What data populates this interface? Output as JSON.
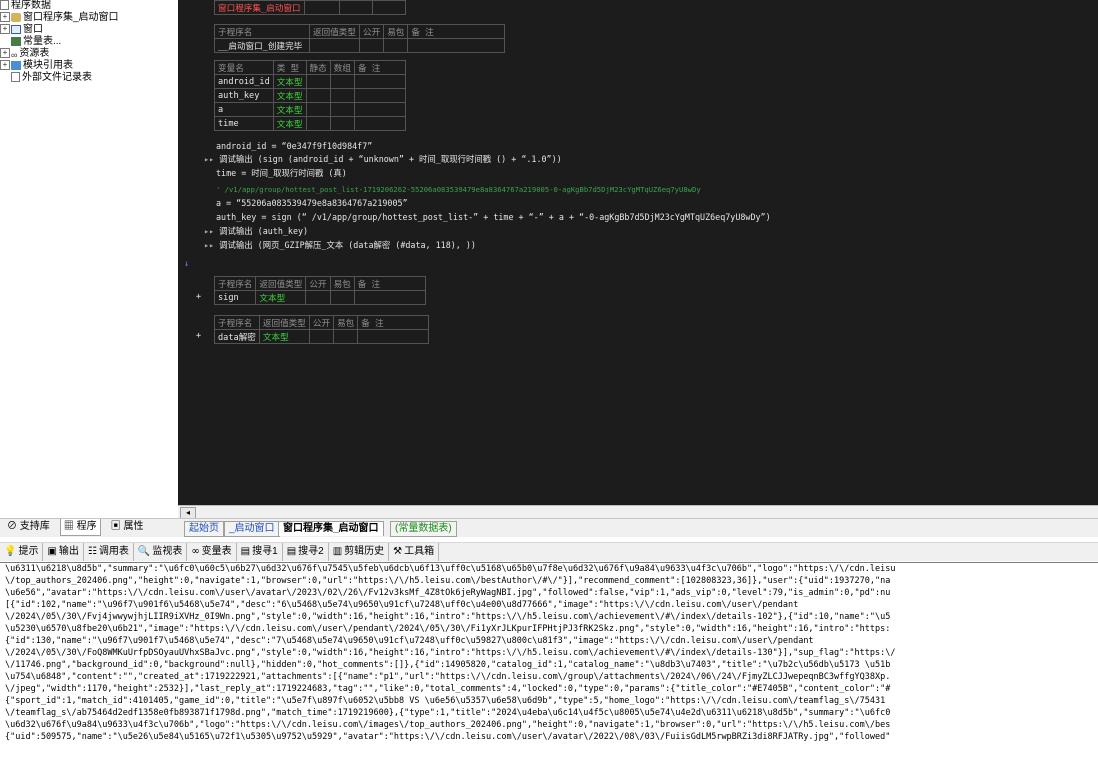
{
  "tree": [
    {
      "toggle": "",
      "icon": "file",
      "label": "程序数据"
    },
    {
      "toggle": "+",
      "icon": "db",
      "label": "窗口程序集_启动窗口"
    },
    {
      "toggle": "+",
      "icon": "win",
      "label": "窗口"
    },
    {
      "toggle": "",
      "icon": "const",
      "label": "常量表..."
    },
    {
      "toggle": "+",
      "icon": "res",
      "label": "资源表"
    },
    {
      "toggle": "+",
      "icon": "mod",
      "label": "模块引用表"
    },
    {
      "toggle": "",
      "icon": "file",
      "label": "外部文件记录表"
    }
  ],
  "code": {
    "top_label": "窗口程序集_启动窗口",
    "sub_header": [
      "子程序名",
      "返回值类型",
      "公开",
      "易包",
      "备 注"
    ],
    "sub_name": "__启动窗口_创建完毕",
    "var_header": [
      "变量名",
      "类 型",
      "静态",
      "数组",
      "备 注"
    ],
    "vars": [
      {
        "name": "android_id",
        "type": "文本型"
      },
      {
        "name": "auth_key",
        "type": "文本型"
      },
      {
        "name": "a",
        "type": "文本型"
      },
      {
        "name": "time",
        "type": "文本型"
      }
    ],
    "line1": "android_id = “0e347f9f10d984f7”",
    "line2": "调试输出 (sign (android_id + “unknown” + 时间_取现行时间戳 () + “.1.0”))",
    "line3": "time = 时间_取现行时间戳 (真)",
    "line4": "' /v1/app/group/hottest_post_list-1719206262-55206a083539479e8a8364767a219005-0-agKgBb7d5DjM23cYgMTqUZ6eq7yU8wDy",
    "line5": "a = “55206a083539479e8a8364767a219005”",
    "line6": "auth_key = sign (“ /v1/app/group/hottest_post_list-” + time + “-” + a + “-0-agKgBb7d5DjM23cYgMTqUZ6eq7yU8wDy”)",
    "line7": "调试输出 (auth_key)",
    "line8": "调试输出 (网页_GZIP解压_文本 (data解密 (#data, 118), ))",
    "sign_header": [
      "子程序名",
      "返回值类型",
      "公开",
      "易包",
      "备 注"
    ],
    "sign_name": "sign",
    "sign_type": "文本型",
    "dec_header": [
      "子程序名",
      "返回值类型",
      "公开",
      "易包",
      "备 注"
    ],
    "dec_name": "data解密",
    "dec_type": "文本型"
  },
  "left_tabs": [
    "支持库",
    "程序",
    "属性"
  ],
  "editor_tabs": [
    "起始页",
    "_启动窗口",
    "窗口程序集_启动窗口",
    "(常量数据表)"
  ],
  "output_toolbar": [
    {
      "icon": "tip-icon",
      "sym": "💡",
      "label": "提示"
    },
    {
      "icon": "output-icon",
      "sym": "▣",
      "label": "输出"
    },
    {
      "icon": "calltable-icon",
      "sym": "☷",
      "label": "调用表"
    },
    {
      "icon": "monitor-icon",
      "sym": "🔍",
      "label": "监视表"
    },
    {
      "icon": "vartable-icon",
      "sym": "∞",
      "label": "变量表"
    },
    {
      "icon": "search1-icon",
      "sym": "▤",
      "label": "搜寻1"
    },
    {
      "icon": "search2-icon",
      "sym": "▤",
      "label": "搜寻2"
    },
    {
      "icon": "clipboard-icon",
      "sym": "▥",
      "label": "剪辑历史"
    },
    {
      "icon": "toolbox-icon",
      "sym": "⚒",
      "label": "工具箱"
    }
  ],
  "output_lines": [
    "\\u6311\\u6218\\u8d5b\",\"summary\":\"\\u6fc0\\u60c5\\u6b27\\u6d32\\u676f\\u7545\\u5feb\\u6dcb\\u6f13\\uff0c\\u5168\\u65b0\\u7f8e\\u6d32\\u676f\\u9a84\\u9633\\u4f3c\\u706b\",\"logo\":\"https:\\/\\/cdn.leisu",
    "\\/top_authors_202406.png\",\"height\":0,\"navigate\":1,\"browser\":0,\"url\":\"https:\\/\\/h5.leisu.com\\/bestAuthor\\/#\\/\"}],\"recommend_comment\":[102808323,36]},\"user\":{\"uid\":1937270,\"na",
    "\\u6e56\",\"avatar\":\"https:\\/\\/cdn.leisu.com\\/user\\/avatar\\/2023\\/02\\/26\\/Fv12v3ksMf_4Z8tOk6jeRyWagNBI.jpg\",\"followed\":false,\"vip\":1,\"ads_vip\":0,\"level\":79,\"is_admin\":0,\"pd\":nu",
    "[{\"id\":102,\"name\":\"\\u96f7\\u901f6\\u5468\\u5e74\",\"desc\":\"6\\u5468\\u5e74\\u9650\\u91cf\\u7248\\uff0c\\u4e00\\u8d77666\",\"image\":\"https:\\/\\/cdn.leisu.com\\/user\\/pendant",
    "\\/2024\\/05\\/30\\/Fvj4jwwywjhjLIIR9iXVHz_0I9Wn.png\",\"style\":0,\"width\":16,\"height\":16,\"intro\":\"https:\\/\\/h5.leisu.com\\/achievement\\/#\\/index\\/details-102\"},{\"id\":10,\"name\":\"\\u5",
    "\\u5230\\u6570\\u8fbe20\\u6b21\",\"image\":\"https:\\/\\/cdn.leisu.com\\/user\\/pendant\\/2024\\/05\\/30\\/Fi1yXrJLKpurIFPHtjPJ3fRK2Skz.png\",\"style\":0,\"width\":16,\"height\":16,\"intro\":\"https:",
    "{\"id\":130,\"name\":\"\\u96f7\\u901f7\\u5468\\u5e74\",\"desc\":\"7\\u5468\\u5e74\\u9650\\u91cf\\u7248\\uff0c\\u59827\\u800c\\u81f3\",\"image\":\"https:\\/\\/cdn.leisu.com\\/user\\/pendant",
    "\\/2024\\/05\\/30\\/FoQ8WMKuUrfpDSOyauUVhxSBaJvc.png\",\"style\":0,\"width\":16,\"height\":16,\"intro\":\"https:\\/\\/h5.leisu.com\\/achievement\\/#\\/index\\/details-130\"}],\"sup_flag\":\"https:\\/",
    "\\/11746.png\",\"background_id\":0,\"background\":null},\"hidden\":0,\"hot_comments\":[]},{\"id\":14905820,\"catalog_id\":1,\"catalog_name\":\"\\u8db3\\u7403\",\"title\":\"\\u7b2c\\u56db\\u5173 \\u51b",
    "\\u754\\u6848\",\"content\":\"\",\"created_at\":1719222921,\"attachments\":[{\"name\":\"p1\",\"url\":\"https:\\/\\/cdn.leisu.com\\/group\\/attachments\\/2024\\/06\\/24\\/FjmyZLCJJwepeqnBC3wffgYQ38Xp.",
    "\\/jpeg\",\"width\":1170,\"height\":2532}],\"last_reply_at\":1719224683,\"tag\":\"\",\"like\":0,\"total_comments\":4,\"locked\":0,\"type\":0,\"params\":{\"title_color\":\"#E7405B\",\"content_color\":\"#",
    "{\"sport_id\":1,\"match_id\":4101405,\"game_id\":0,\"title\":\"\\u5e7f\\u897f\\u6052\\u5bb8 VS \\u6e56\\u5357\\u6e58\\u6d9b\",\"type\":5,\"home_logo\":\"https:\\/\\/cdn.leisu.com\\/teamflag_s\\/75431",
    "\\/teamflag_s\\/ab75464d2edf1358e0fb893871f1798d.png\",\"match_time\":1719219600},{\"type\":1,\"title\":\"2024\\u4eba\\u6c14\\u4f5c\\u8005\\u5e74\\u4e2d\\u6311\\u6218\\u8d5b\",\"summary\":\"\\u6fc0",
    "\\u6d32\\u676f\\u9a84\\u9633\\u4f3c\\u706b\",\"logo\":\"https:\\/\\/cdn.leisu.com\\/images\\/top_authors_202406.png\",\"height\":0,\"navigate\":1,\"browser\":0,\"url\":\"https:\\/\\/h5.leisu.com\\/bes",
    "{\"uid\":509575,\"name\":\"\\u5e26\\u5e84\\u5165\\u72f1\\u5305\\u9752\\u5929\",\"avatar\":\"https:\\/\\/cdn.leisu.com\\/user\\/avatar\\/2022\\/08\\/03\\/FuiisGdLM5rwpBRZi3di8RFJATRy.jpg\",\"followed\""
  ]
}
